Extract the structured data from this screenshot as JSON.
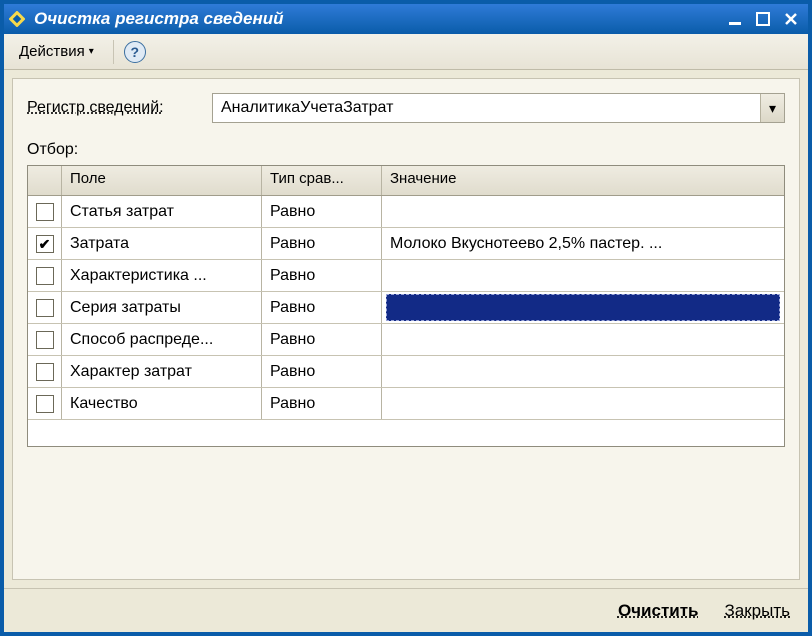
{
  "window": {
    "title": "Очистка регистра сведений"
  },
  "toolbar": {
    "actions_label": "Действия"
  },
  "register": {
    "label": "Регистр сведений:",
    "value": "АналитикаУчетаЗатрат"
  },
  "filter": {
    "label": "Отбор:",
    "columns": {
      "field": "Поле",
      "compare": "Тип срав...",
      "value": "Значение"
    },
    "rows": [
      {
        "checked": false,
        "field": "Статья затрат",
        "compare": "Равно",
        "value": "",
        "selected": false
      },
      {
        "checked": true,
        "field": "Затрата",
        "compare": "Равно",
        "value": "Молоко   Вкуснотеево 2,5% пастер.   ...",
        "selected": false
      },
      {
        "checked": false,
        "field": "Характеристика ...",
        "compare": "Равно",
        "value": "",
        "selected": false
      },
      {
        "checked": false,
        "field": "Серия затраты",
        "compare": "Равно",
        "value": "",
        "selected": true
      },
      {
        "checked": false,
        "field": "Способ распреде...",
        "compare": "Равно",
        "value": "",
        "selected": false
      },
      {
        "checked": false,
        "field": "Характер затрат",
        "compare": "Равно",
        "value": "",
        "selected": false
      },
      {
        "checked": false,
        "field": "Качество",
        "compare": "Равно",
        "value": "",
        "selected": false
      }
    ]
  },
  "footer": {
    "clear": "Очистить",
    "close": "Закрыть"
  }
}
